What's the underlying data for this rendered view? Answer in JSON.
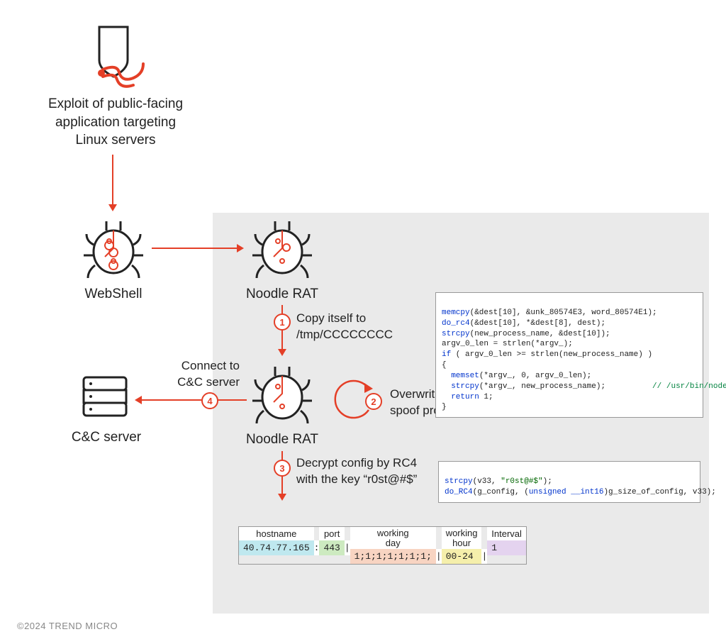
{
  "labels": {
    "exploit": "Exploit of public-facing\napplication targeting\nLinux servers",
    "webshell": "WebShell",
    "noodle1": "Noodle RAT",
    "noodle2": "Noodle RAT",
    "ccserver": "C&C server",
    "step1": "Copy itself to\n/tmp/CCCCCCCC",
    "step2": "Overwrite “argv” to\nspoof process name",
    "step3": "Decrypt config by RC4\nwith the key “r0st@#$”",
    "step4": "Connect to\nC&C server"
  },
  "steps": {
    "s1": "1",
    "s2": "2",
    "s3": "3",
    "s4": "4"
  },
  "code1": {
    "l1a": "memcpy",
    "l1b": "(&dest[10], &unk_80574E3, word_80574E1);",
    "l2a": "do_rc4",
    "l2b": "(&dest[10], *&dest[8], dest);",
    "l3a": "strcpy",
    "l3b": "(new_process_name, &dest[10]);",
    "l4": "argv_0_len = strlen(*argv_);",
    "l5a": "if",
    "l5b": " ( argv_0_len >= strlen(new_process_name) )",
    "l6": "{",
    "l7a": "  memset",
    "l7b": "(*argv_, 0, argv_0_len);",
    "l8a": "  strcpy",
    "l8b": "(*argv_, new_process_name);",
    "l8c": "          // /usr/bin/node",
    "l9a": "  return",
    "l9b": " 1;",
    "l10": "}"
  },
  "code2": {
    "l1a": "strcpy",
    "l1b": "(v33, ",
    "l1c": "\"r0st@#$\"",
    "l1d": ");",
    "l2a": "do_RC4",
    "l2b": "(g_config, (",
    "l2c": "unsigned __int16",
    "l2d": ")g_size_of_config, v33);"
  },
  "config": {
    "headers": {
      "hostname": "hostname",
      "port": "port",
      "day": "working\nday",
      "hour": "working\nhour",
      "interval": "Interval"
    },
    "values": {
      "hostname": "40.74.77.165",
      "port": "443",
      "day": "1;1;1;1;1;1;1;",
      "hour": "00-24",
      "interval": "1"
    },
    "seps": {
      "colon": ":",
      "pipe": "|"
    }
  },
  "footer": "©2024 TREND MICRO"
}
